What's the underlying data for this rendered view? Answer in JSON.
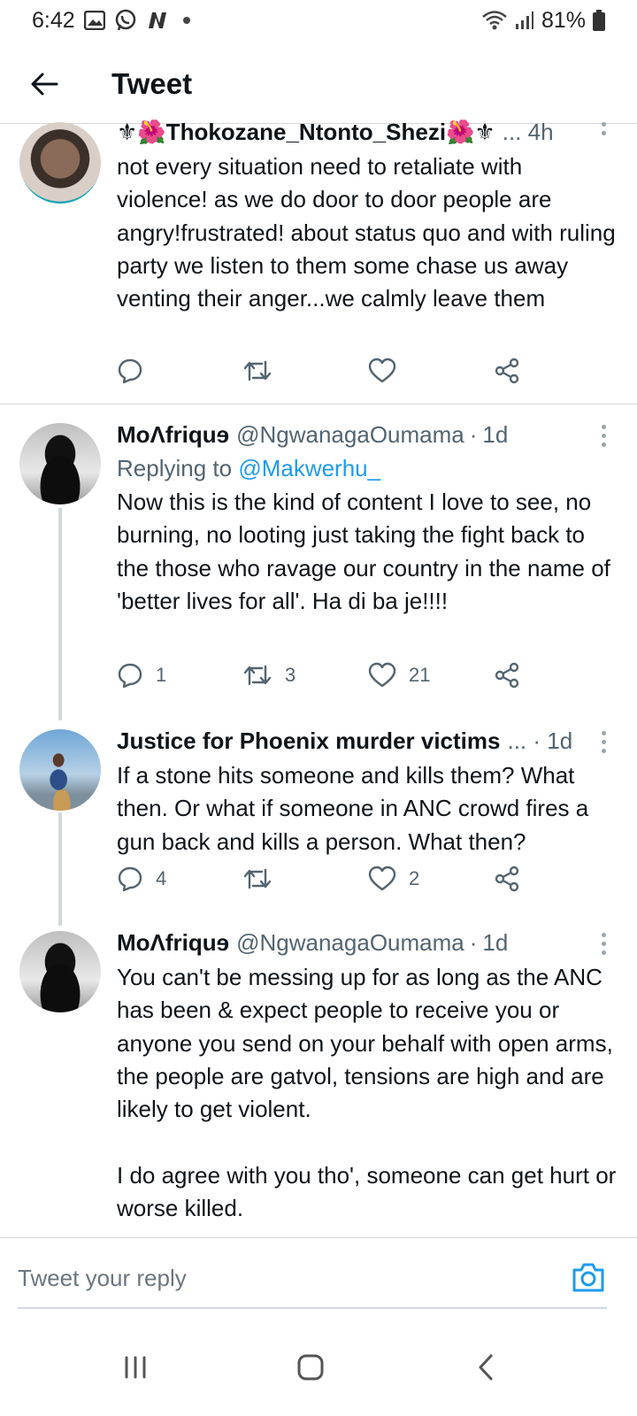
{
  "status_bar": {
    "time": "6:42",
    "battery": "81%",
    "icons_left": [
      "gallery-icon",
      "whatsapp-icon",
      "n-app-icon",
      "dot"
    ],
    "icons_right": [
      "wifi-icon",
      "signal-icon",
      "battery-icon"
    ]
  },
  "header": {
    "title": "Tweet"
  },
  "tweets": [
    {
      "name": "⚜🌺Thokozane_Ntonto_Shezi🌺⚜",
      "meta_suffix": "... 4h",
      "text": "not every situation need to retaliate with violence! as we do door to door people are angry!frustrated! about status quo and with ruling party we listen to them some chase us away venting their anger...we calmly leave them",
      "actions": {
        "replies": "",
        "retweets": "",
        "likes": ""
      }
    },
    {
      "name": "MoΛfriquɘ",
      "handle": "@NgwanagaOumama",
      "time": "1d",
      "replying_prefix": "Replying to",
      "replying_to": "@Makwerhu_",
      "text": "Now this is the kind of content I love to see, no burning, no looting just taking the fight back to the those who ravage our country in the name of 'better lives for all'. Ha di ba je!!!!",
      "actions": {
        "replies": "1",
        "retweets": "3",
        "likes": "21"
      }
    },
    {
      "name": "Justice for Phoenix murder victims",
      "meta_suffix": "... · 1d",
      "text": "If a stone hits someone and kills them? What then. Or what if someone in ANC crowd fires a gun back and kills a person. What then?",
      "actions": {
        "replies": "4",
        "retweets": "",
        "likes": "2"
      }
    },
    {
      "name": "MoΛfriquɘ",
      "handle": "@NgwanagaOumama",
      "time": "1d",
      "text": "You can't be messing up for as long as the ANC has been & expect people to receive you or anyone you send on your behalf with open arms, the people are gatvol, tensions are high and are likely to get violent.\n\nI do agree with you tho', someone can get hurt or worse killed."
    }
  ],
  "reply_bar": {
    "placeholder": "Tweet your reply"
  },
  "colors": {
    "accent": "#1d9bf0",
    "text": "#0f1419",
    "secondary": "#536471",
    "divider": "#d6d6d6"
  }
}
